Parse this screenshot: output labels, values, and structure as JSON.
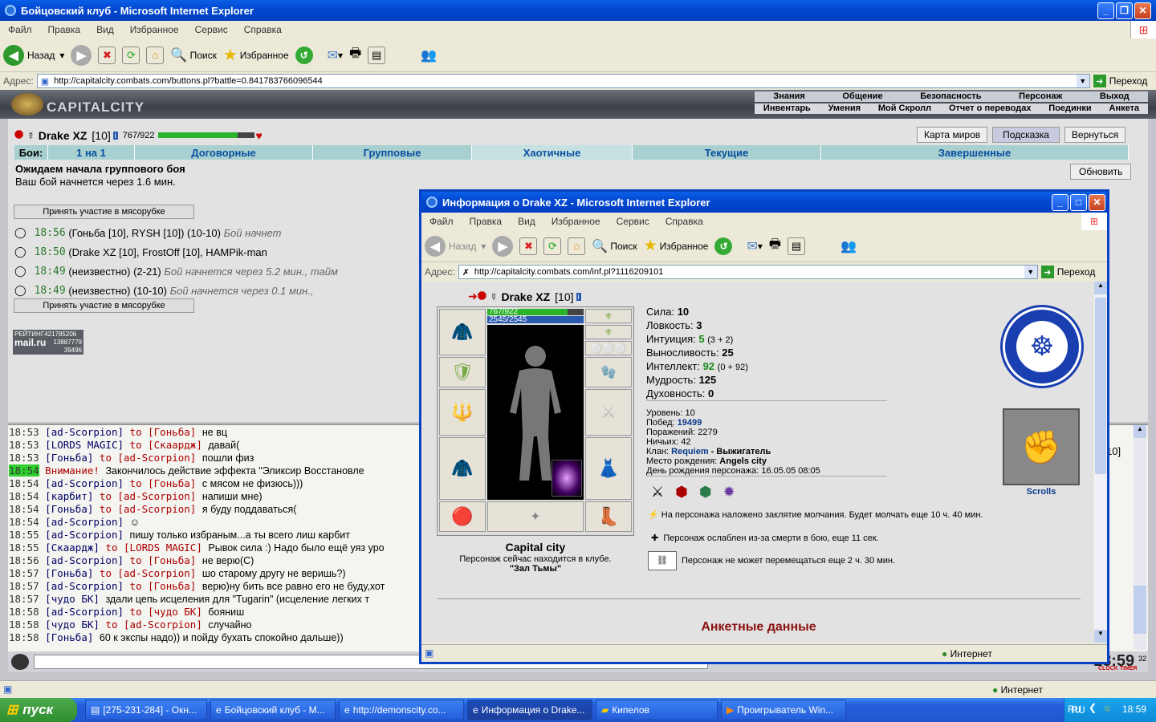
{
  "main_window": {
    "title": "Бойцовский клуб - Microsoft Internet Explorer",
    "menu": [
      "Файл",
      "Правка",
      "Вид",
      "Избранное",
      "Сервис",
      "Справка"
    ],
    "toolbar": {
      "back": "Назад",
      "search": "Поиск",
      "favorites": "Избранное"
    },
    "address_label": "Адрес:",
    "url": "http://capitalcity.combats.com/buttons.pl?battle=0.841783766096544",
    "go": "Переход",
    "status_zone": "Интернет"
  },
  "game": {
    "logo": "CAPITALCITY",
    "top_links": [
      "Знания",
      "Общение",
      "Безопасность",
      "Персонаж",
      "Выход"
    ],
    "sub_links": [
      "Инвентарь",
      "Умения",
      "Мой Скролл",
      "Отчет о переводах",
      "Поединки",
      "Анкета"
    ],
    "player": {
      "name": "Drake XZ",
      "level": "[10]",
      "hp": "767/922",
      "hp_fraction": 0.83
    },
    "buttons": {
      "map": "Карта миров",
      "hint": "Подсказка",
      "back": "Вернуться",
      "refresh": "Обновить"
    },
    "tabs_label": "Бои:",
    "tabs": [
      "1 на 1",
      "Договорные",
      "Групповые",
      "Хаотичные",
      "Текущие",
      "Завершенные"
    ],
    "wait_title": "Ожидаем начала группового боя",
    "wait_text": "Ваш бой начнется через 1.6 мин.",
    "join_label": "Принять участие в мясорубке",
    "battles": [
      {
        "time": "18:56",
        "text": "(Гоньба [10], RYSH [10]) (10-10)",
        "tail": "Бой начнет"
      },
      {
        "time": "18:50",
        "text": "(Drake XZ [10], FrostOff [10], HAMPik-man",
        "tail": ""
      },
      {
        "time": "18:49",
        "text": "(неизвестно) (2-21)",
        "tail": "Бой начнется через 5.2 мин., тайм"
      },
      {
        "time": "18:49",
        "text": "(неизвестно) (10-10)",
        "tail": "Бой начнется через 0.1 мин.,"
      }
    ],
    "rating": {
      "label": "РЕЙТИНГ",
      "a": "421785206",
      "b": "13887779",
      "c": "39496",
      "brand": "mail.ru"
    },
    "chat": [
      {
        "time": "18:53",
        "who": "[ad-Scorpion]",
        "to": "to [Гоньба]",
        "msg": "не вц"
      },
      {
        "time": "18:53",
        "who": "[LORDS MAGIC]",
        "to": "to [Скаардж]",
        "msg": "давай("
      },
      {
        "time": "18:53",
        "who": "[Гоньба]",
        "to": "to [ad-Scorpion]",
        "msg": "пошли физ"
      },
      {
        "time": "18:54",
        "who": "",
        "to": "Внимание!",
        "msg": "Закончилось действие эффекта \"Эликсир Восстановле"
      },
      {
        "time": "18:54",
        "who": "[ad-Scorpion]",
        "to": "to [Гоньба]",
        "msg": "с мясом не физюсь)))"
      },
      {
        "time": "18:54",
        "who": "[карбит]",
        "to": "to [ad-Scorpion]",
        "msg": "напиши мне)"
      },
      {
        "time": "18:54",
        "who": "[Гоньба]",
        "to": "to [ad-Scorpion]",
        "msg": "я буду поддаваться("
      },
      {
        "time": "18:54",
        "who": "[ad-Scorpion]",
        "to": "",
        "msg": "☺"
      },
      {
        "time": "18:55",
        "who": "[ad-Scorpion]",
        "to": "",
        "msg": "пишу только избраным...а ты всего лиш карбит"
      },
      {
        "time": "18:55",
        "who": "[Скаардж]",
        "to": "to [LORDS MAGIC]",
        "msg": "Рывок сила :) Надо было ещё уяз уро"
      },
      {
        "time": "18:56",
        "who": "[ad-Scorpion]",
        "to": "to [Гоньба]",
        "msg": "не верю(С)"
      },
      {
        "time": "18:57",
        "who": "[Гоньба]",
        "to": "to [ad-Scorpion]",
        "msg": "шо старому другу не веришь?)"
      },
      {
        "time": "18:57",
        "who": "[ad-Scorpion]",
        "to": "to [Гоньба]",
        "msg": "верю)ну бить все равно его не буду,хот"
      },
      {
        "time": "18:57",
        "who": "[чудо БК]",
        "to": "",
        "msg": "здали цепь исцеления для \"Tugarin\" (исцеление легких т"
      },
      {
        "time": "18:58",
        "who": "[ad-Scorpion]",
        "to": "to [чудо БК]",
        "msg": "бояниш"
      },
      {
        "time": "18:58",
        "who": "[чудо БК]",
        "to": "to [ad-Scorpion]",
        "msg": "случайно"
      },
      {
        "time": "18:58",
        "who": "[Гоньба]",
        "to": "",
        "msg": "60 к экспы надо)) и пойду бухать спокойно дальше))"
      }
    ],
    "clock": "18:59",
    "clock_sec": "32",
    "clock_label": "CLOCK TIMER"
  },
  "popup": {
    "title": "Информация о Drake XZ - Microsoft Internet Explorer",
    "url": "http://capitalcity.combats.com/inf.pl?1116209101",
    "hp": "767/922",
    "mana": "2545/2545",
    "stats": [
      {
        "k": "Сила:",
        "v": "10",
        "x": ""
      },
      {
        "k": "Ловкость:",
        "v": "3",
        "x": ""
      },
      {
        "k": "Интуиция:",
        "v": "5",
        "x": "(3 + 2)"
      },
      {
        "k": "Выносливость:",
        "v": "25",
        "x": ""
      },
      {
        "k": "Интеллект:",
        "v": "92",
        "x": "(0 + 92)"
      },
      {
        "k": "Мудрость:",
        "v": "125",
        "x": ""
      },
      {
        "k": "Духовность:",
        "v": "0",
        "x": ""
      }
    ],
    "info": {
      "level": "Уровень: 10",
      "wins_l": "Побед:",
      "wins": "19499",
      "losses": "Поражений: 2279",
      "draws": "Ничьих: 42",
      "clan_l": "Клан:",
      "clan": "Requiem",
      "clan_rank": "- Выжигатель",
      "birth_l": "Место рождения:",
      "birth": "Angels city",
      "bday": "День рождения персонажа: 16.05.05 08:05"
    },
    "effects": [
      "На персонажа наложено заклятие молчания. Будет молчать еще 10 ч. 40 мин.",
      "Персонаж ослаблен из-за смерти в бою, еще 11 сек.",
      "Персонаж не может перемещаться еще 2 ч. 30 мин."
    ],
    "location_title": "Capital city",
    "location_text": "Персонаж сейчас находится в клубе.",
    "room": "\"Зал Тьмы\"",
    "scrolls": "Scrolls",
    "anketa": "Анкетные данные"
  },
  "taskbar": {
    "start": "пуск",
    "tasks": [
      "[275-231-284] - Окн...",
      "Бойцовский клуб - M...",
      "http://demonscity.co...",
      "Информация о Drake...",
      "Кипелов",
      "Проигрыватель Win..."
    ],
    "lang": "RU",
    "time": "18:59"
  }
}
